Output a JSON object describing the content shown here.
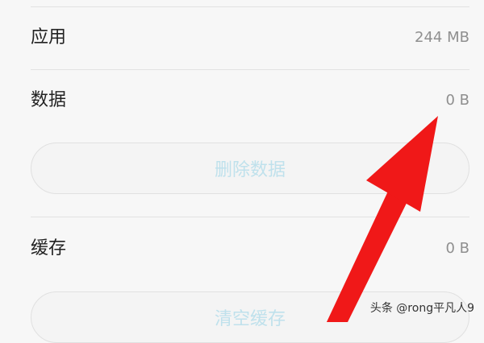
{
  "rows": {
    "app": {
      "label": "应用",
      "value": "244 MB"
    },
    "data": {
      "label": "数据",
      "value": "0 B"
    },
    "cache": {
      "label": "缓存",
      "value": "0 B"
    }
  },
  "buttons": {
    "delete_data": "删除数据",
    "clear_cache": "清空缓存"
  },
  "watermark": "头条 @rong平凡人9",
  "colors": {
    "background": "#f7f7f7",
    "button_text_disabled": "#bfe1ec",
    "annotation_arrow": "#f01818"
  },
  "icons": {
    "annotation": "red-arrow-annotation"
  }
}
